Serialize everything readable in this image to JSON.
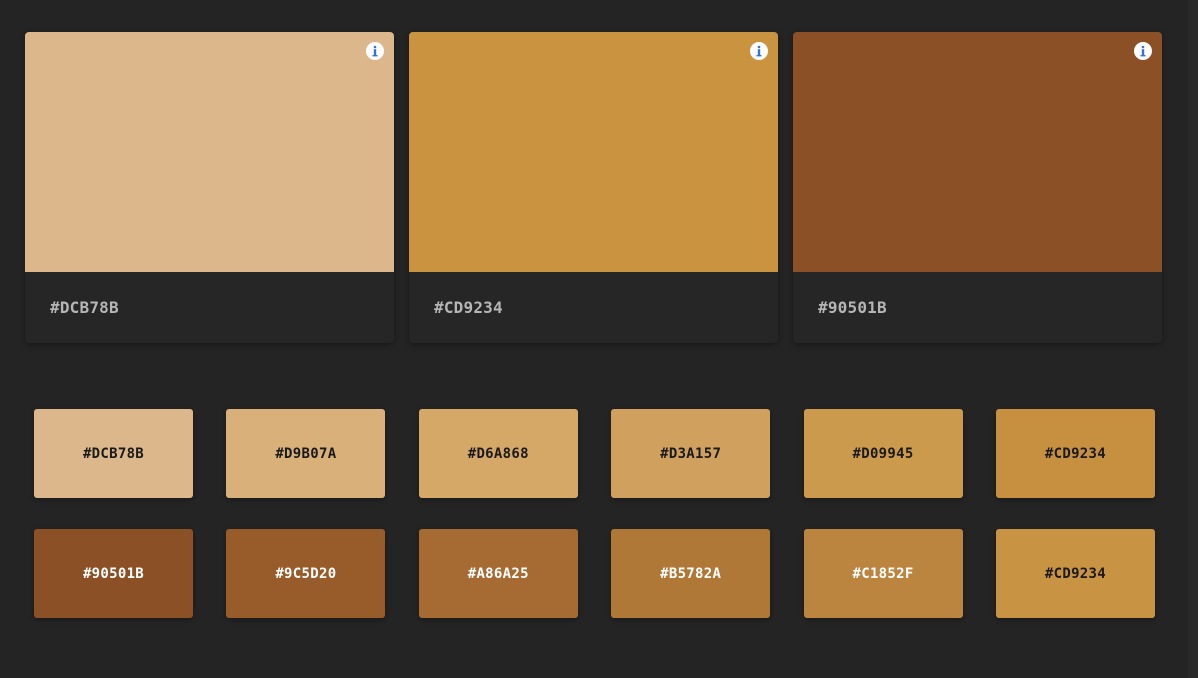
{
  "colors": {
    "background": "#242424",
    "card_label": "#b5b5b5",
    "info_icon_blue": "#3b6fd6"
  },
  "main_palette": [
    {
      "hex": "#DCB78B",
      "color": "#DCB78B",
      "icon": "info-icon"
    },
    {
      "hex": "#CD9234",
      "color": "#C99340",
      "icon": "info-icon"
    },
    {
      "hex": "#90501B",
      "color": "#8B5025",
      "icon": "info-icon"
    }
  ],
  "shades_row1": [
    {
      "hex": "#DCB78B",
      "color": "#DCB78B",
      "text_color": "#1a1a1a"
    },
    {
      "hex": "#D9B07A",
      "color": "#D9B07A",
      "text_color": "#1a1a1a"
    },
    {
      "hex": "#D6A868",
      "color": "#D6A868",
      "text_color": "#1a1a1a"
    },
    {
      "hex": "#D3A157",
      "color": "#D0A15E",
      "text_color": "#1a1a1a"
    },
    {
      "hex": "#D09945",
      "color": "#CC9A4C",
      "text_color": "#1a1a1a"
    },
    {
      "hex": "#CD9234",
      "color": "#C79040",
      "text_color": "#1a1a1a"
    }
  ],
  "shades_row2": [
    {
      "hex": "#90501B",
      "color": "#8B5025",
      "text_color": "#ffffff"
    },
    {
      "hex": "#9C5D20",
      "color": "#985C2A",
      "text_color": "#ffffff"
    },
    {
      "hex": "#A86A25",
      "color": "#A66B32",
      "text_color": "#ffffff"
    },
    {
      "hex": "#B5782A",
      "color": "#B07837",
      "text_color": "#ffffff"
    },
    {
      "hex": "#C1852F",
      "color": "#BC853F",
      "text_color": "#ffffff"
    },
    {
      "hex": "#CD9234",
      "color": "#C99344",
      "text_color": "#1a1a1a"
    }
  ]
}
